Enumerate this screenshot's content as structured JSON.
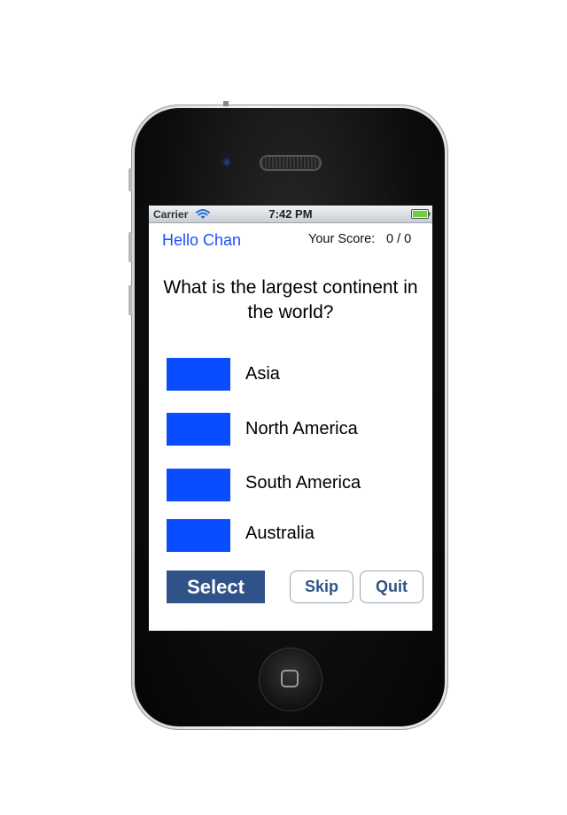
{
  "status_bar": {
    "carrier": "Carrier",
    "time": "7:42 PM",
    "wifi_icon": "wifi-icon",
    "battery_icon": "battery-icon"
  },
  "header": {
    "greeting": "Hello Chan",
    "score_label": "Your Score:",
    "score_value": "0 / 0"
  },
  "question": {
    "text": "What is the largest continent in the world?"
  },
  "options": [
    {
      "label": "Asia",
      "color": "#0a4cff"
    },
    {
      "label": "North America",
      "color": "#0a4cff"
    },
    {
      "label": "South America",
      "color": "#0a4cff"
    },
    {
      "label": "Australia",
      "color": "#0a4cff"
    }
  ],
  "actions": {
    "select_label": "Select",
    "skip_label": "Skip",
    "quit_label": "Quit"
  },
  "colors": {
    "accent_blue": "#1a4fff",
    "button_blue": "#2f5288"
  }
}
